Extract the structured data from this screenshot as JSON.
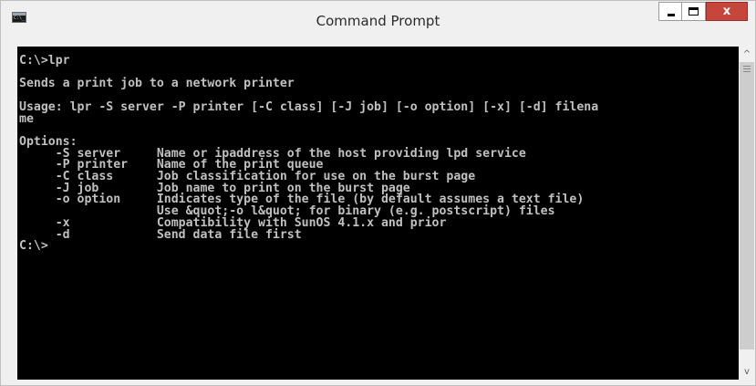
{
  "window": {
    "title": "Command Prompt",
    "app_icon_text": "C:\\_",
    "controls": {
      "minimize": "minimize-icon",
      "maximize": "maximize-icon",
      "close_glyph": "x"
    },
    "colors": {
      "console_bg": "#000000",
      "console_fg": "#c0c0c0",
      "close_button": "#c7463b",
      "chrome": "#f0f0f0"
    }
  },
  "console": {
    "lines": [
      "C:\\>lpr",
      "",
      "Sends a print job to a network printer",
      "",
      "Usage: lpr -S server -P printer [-C class] [-J job] [-o option] [-x] [-d] filena",
      "me",
      "",
      "Options:",
      "     -S server     Name or ipaddress of the host providing lpd service",
      "     -P printer    Name of the print queue",
      "     -C class      Job classification for use on the burst page",
      "     -J job        Job name to print on the burst page",
      "     -o option     Indicates type of the file (by default assumes a text file)",
      "                   Use &quot;-o l&quot; for binary (e.g. postscript) files",
      "     -x            Compatibility with SunOS 4.1.x and prior",
      "     -d            Send data file first",
      "C:\\>"
    ]
  },
  "scrollbar": {
    "up_arrow": "^",
    "down_arrow": "v"
  }
}
